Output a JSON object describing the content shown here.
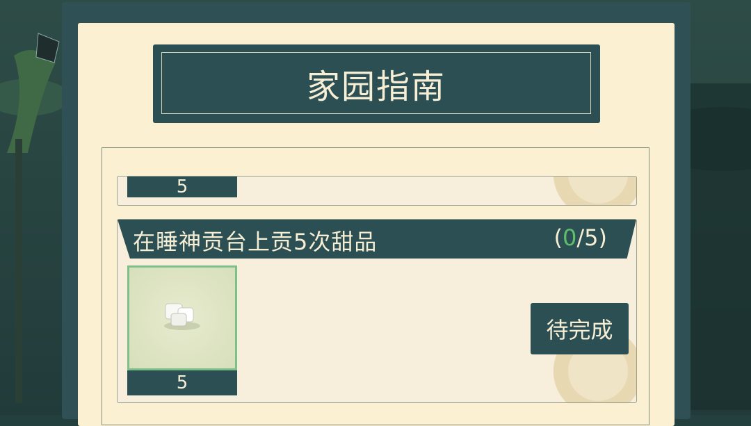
{
  "dialog": {
    "title": "家园指南"
  },
  "tasks": [
    {
      "count": "5"
    },
    {
      "title": "在睡神贡台上贡5次甜品",
      "progress_open": "(",
      "progress_current": "0",
      "progress_rest": "/5)",
      "reward_icon": "sugar-cube-icon",
      "reward_count": "5",
      "status_label": "待完成"
    }
  ],
  "colors": {
    "panel_bg": "#fbf1d2",
    "header_bg": "#2b4f53",
    "progress_current": "#5fbf6a",
    "slot_border": "#7ec08a"
  }
}
